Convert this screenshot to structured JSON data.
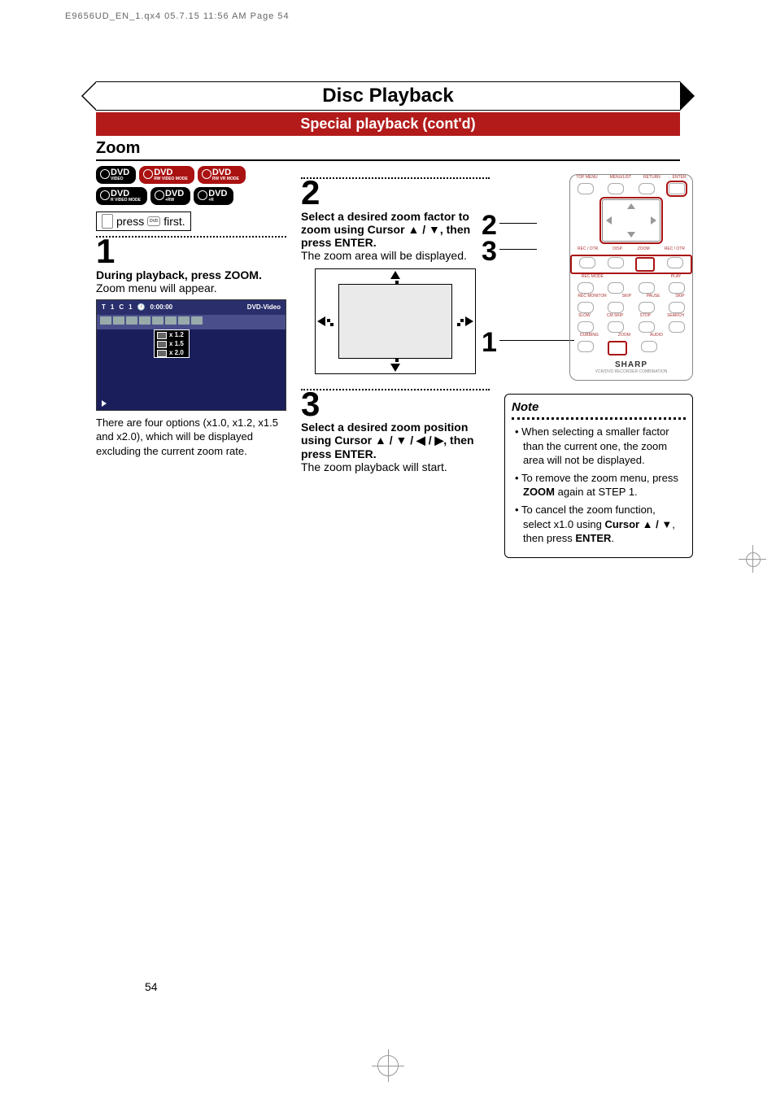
{
  "crop_header": "E9656UD_EN_1.qx4  05.7.15  11:56 AM  Page 54",
  "page_number": "54",
  "title": "Disc Playback",
  "subtitle": "Special playback (cont'd)",
  "section": "Zoom",
  "disc_badges": [
    {
      "main": "DVD",
      "sub": "VIDEO",
      "red": false
    },
    {
      "main": "DVD",
      "sub": "RW VIDEO MODE",
      "red": true
    },
    {
      "main": "DVD",
      "sub": "RW VR MODE",
      "red": true
    },
    {
      "main": "DVD",
      "sub": "R VIDEO MODE",
      "red": false
    },
    {
      "main": "DVD",
      "sub": "+RW",
      "red": false
    },
    {
      "main": "DVD",
      "sub": "+R",
      "red": false
    }
  ],
  "press_first": {
    "pre": "press",
    "btn": "DVD",
    "post": " first."
  },
  "step1": {
    "num": "1",
    "bold": "During playback, press ZOOM.",
    "text": "Zoom menu will appear.",
    "under": "There are four options (x1.0, x1.2, x1.5 and x2.0), which will be displayed excluding the current zoom rate."
  },
  "osd": {
    "t": "T",
    "t_val": "1",
    "c": "C",
    "c_val": "1",
    "time": "0:00:00",
    "type": "DVD-Video",
    "zoom_opts": [
      "x 1.2",
      "x 1.5",
      "x 2.0"
    ]
  },
  "step2": {
    "num": "2",
    "bold": "Select a desired zoom factor to zoom using Cursor ▲ / ▼, then press ENTER.",
    "text": "The zoom area will be displayed."
  },
  "step3": {
    "num": "3",
    "bold": "Select a desired zoom position using Cursor ▲ / ▼ / ◀ / ▶, then press ENTER.",
    "text": "The zoom playback will start."
  },
  "remote": {
    "labels_row1": [
      "TOP MENU",
      "MENU/LIST",
      "RETURN",
      "ENTER"
    ],
    "labels_row2": [
      "REC / OTR",
      "DISP.",
      "ZOOM",
      "REC / OTR"
    ],
    "labels_row3": [
      "REC MODE",
      "",
      "",
      "PLAY"
    ],
    "labels_row4": [
      "REC MONITOR",
      "SKIP",
      "PAUSE",
      "SKIP"
    ],
    "labels_row5": [
      "SLOW",
      "CM SKIP",
      "STOP",
      "SEARCH"
    ],
    "labels_row6": [
      "DUBBING",
      "ZOOM",
      "AUDIO",
      ""
    ],
    "brand": "SHARP",
    "sub": "VCR/DVD RECORDER COMBINATION"
  },
  "callouts": {
    "one": "1",
    "two": "2",
    "three": "3"
  },
  "note": {
    "title": "Note",
    "items": [
      "When selecting a smaller factor than the current one, the zoom area will not be displayed.",
      "To remove the zoom menu, press <b>ZOOM</b> again at STEP 1.",
      "To cancel the zoom function, select x1.0 using <b>Cursor ▲ / ▼</b>, then press <b>ENTER</b>."
    ]
  }
}
